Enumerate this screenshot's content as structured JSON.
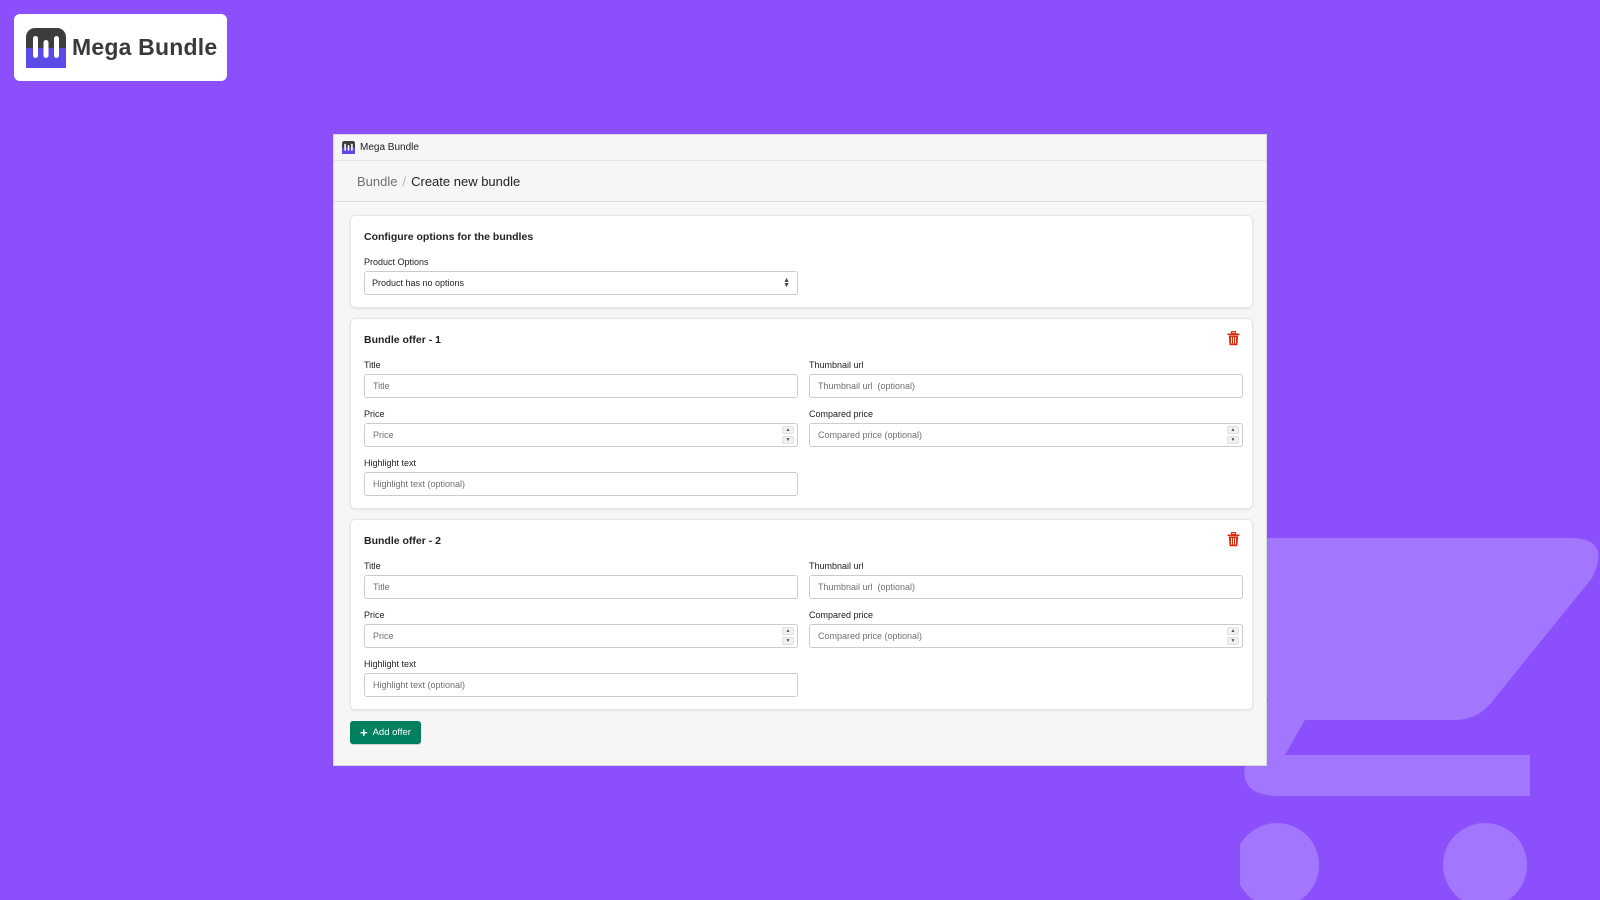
{
  "brand": {
    "name": "Mega Bundle",
    "bg_color": "#8b50fc",
    "accent": "#5b3fe0"
  },
  "app": {
    "topbar_title": "Mega Bundle",
    "breadcrumb": {
      "parent": "Bundle",
      "separator": "/",
      "current": "Create new bundle"
    }
  },
  "options_card": {
    "title": "Configure options for the bundles",
    "label": "Product Options",
    "selected": "Product has no options"
  },
  "offers": [
    {
      "title": "Bundle offer - 1",
      "labels": {
        "title": "Title",
        "thumbnail": "Thumbnail url",
        "price": "Price",
        "compared": "Compared price",
        "highlight": "Highlight text"
      },
      "placeholders": {
        "title": "Title",
        "thumbnail": "Thumbnail url  (optional)",
        "price": "Price",
        "compared": "Compared price (optional)",
        "highlight": "Highlight text (optional)"
      }
    },
    {
      "title": "Bundle offer - 2",
      "labels": {
        "title": "Title",
        "thumbnail": "Thumbnail url",
        "price": "Price",
        "compared": "Compared price",
        "highlight": "Highlight text"
      },
      "placeholders": {
        "title": "Title",
        "thumbnail": "Thumbnail url  (optional)",
        "price": "Price",
        "compared": "Compared price (optional)",
        "highlight": "Highlight text (optional)"
      }
    }
  ],
  "add_offer_label": "Add offer",
  "colors": {
    "primary_button": "#008060",
    "danger_icon": "#d72c0d"
  },
  "icons": {
    "delete": "trash-icon",
    "add": "plus-icon"
  }
}
